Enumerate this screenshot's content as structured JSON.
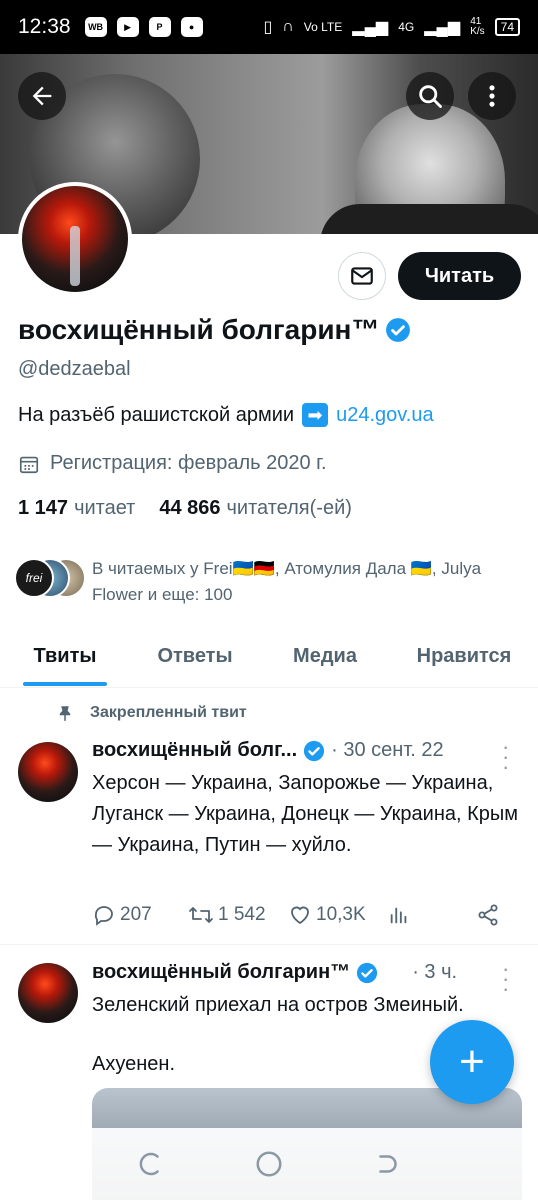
{
  "status_bar": {
    "time": "12:38",
    "apps": [
      "WB"
    ],
    "network_speed": "41\nK/s",
    "battery": "74",
    "net_labels": [
      "Vo LTE",
      "4G"
    ]
  },
  "banner": {
    "back_icon": "arrow-left-icon",
    "search_icon": "search-icon",
    "more_icon": "more-vertical-icon"
  },
  "profile": {
    "name": "восхищённый болгарин™",
    "handle": "@dedzaebal",
    "bio_text": "На разъёб рашистской армии",
    "bio_link": "u24.gov.ua",
    "joined": "Регистрация: февраль 2020 г.",
    "following_count": "1 147",
    "following_label": "читает",
    "followers_count": "44 866",
    "followers_label": "читателя(-ей)",
    "followed_by": "В читаемых у Frei🇺🇦🇩🇪, Атомулия Дала 🇺🇦, Julya Flower и еще: 100",
    "follow_button": "Читать",
    "message_icon": "envelope-icon",
    "verified_color": "#1d9bf0"
  },
  "tabs": [
    {
      "label": "Твиты",
      "active": true
    },
    {
      "label": "Ответы",
      "active": false
    },
    {
      "label": "Медиа",
      "active": false
    },
    {
      "label": "Нравится",
      "active": false
    }
  ],
  "pinned_label": "Закрепленный твит",
  "tweets": [
    {
      "author": "восхищённый болг...",
      "time": "· 30 сент. 22",
      "text": "Херсон — Украина, Запорожье — Украина, Луганск — Украина, Донецк — Украина, Крым — Украина, Путин — хуйло.",
      "replies": "207",
      "retweets": "1 542",
      "likes": "10,3K"
    },
    {
      "author": "восхищённый болгарин™",
      "time": "· 3 ч.",
      "text_line1": "Зеленский приехал на остров Змеиный.",
      "text_line2": "Ахуенен."
    }
  ],
  "compose_button": "+",
  "accent_color": "#1d9bf0"
}
